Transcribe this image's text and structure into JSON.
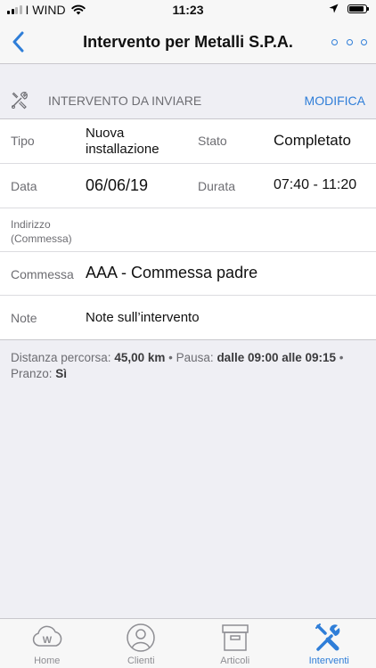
{
  "status_bar": {
    "carrier": "I WIND",
    "time": "11:23",
    "signal_bars": 4,
    "signal_bars_active": 2
  },
  "nav": {
    "title": "Intervento per Metalli S.P.A.",
    "back_icon": "chevron-left-icon",
    "more_icon": "more-icon"
  },
  "section": {
    "title": "INTERVENTO DA INVIARE",
    "action": "MODIFICA",
    "icon": "tools-icon"
  },
  "form": {
    "tipo_label": "Tipo",
    "tipo_value": "Nuova installazione",
    "stato_label": "Stato",
    "stato_value": "Completato",
    "data_label": "Data",
    "data_value": "06/06/19",
    "durata_label": "Durata",
    "durata_value": "07:40 - 11:20",
    "indirizzo_label": "Indirizzo (Commessa)",
    "commessa_label": "Commessa",
    "commessa_value": "AAA - Commessa padre",
    "note_label": "Note",
    "note_value": "Note sull’intervento"
  },
  "summary": {
    "distanza_label": "Distanza percorsa:",
    "distanza_value": "45,00 km",
    "pausa_label": "Pausa:",
    "pausa_value": "dalle 09:00 alle 09:15",
    "pranzo_label": "Pranzo:",
    "pranzo_value": "Sì",
    "separator": "•"
  },
  "tabs": [
    {
      "label": "Home",
      "icon": "home-w-cloud-icon"
    },
    {
      "label": "Clienti",
      "icon": "person-icon"
    },
    {
      "label": "Articoli",
      "icon": "box-icon"
    },
    {
      "label": "Interventi",
      "icon": "tools-icon",
      "active": true
    }
  ],
  "colors": {
    "accent": "#2f7ed8",
    "label_gray": "#6d6d72",
    "background": "#efeff4"
  }
}
